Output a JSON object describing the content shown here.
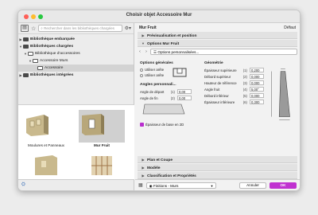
{
  "window": {
    "title": "Choisir objet Accessoire Mur"
  },
  "left": {
    "search_placeholder": "Rechercher dans les bibliothèques chargées",
    "tree": [
      {
        "label": "Bibliothèque embarquée",
        "bold": true
      },
      {
        "label": "Bibliothèques chargées",
        "bold": true
      },
      {
        "label": "Bibliothèque d'accessoires",
        "bold": false
      },
      {
        "label": "Accessoire Murs",
        "bold": false
      },
      {
        "label": "Accessoire",
        "bold": false
      },
      {
        "label": "Bibliothèques intégrées",
        "bold": true
      }
    ],
    "thumbs": [
      {
        "label": "Moulures et Panneaux"
      },
      {
        "label": "Mur Fruit"
      }
    ]
  },
  "right": {
    "object_name": "Mur Fruit",
    "default_label": "Défaut",
    "sections": {
      "preview": "Prévisualisation et position",
      "options": "Options Mur Fruit",
      "plan": "Plan et Coupe",
      "model": "Modèle",
      "classification": "Classification et Propriétés"
    },
    "options_select": "Options personnalisées...",
    "general": {
      "title": "Options générales",
      "radio1": "Utiliser arête",
      "radio2": "Utiliser arête"
    },
    "angles": {
      "title": "Angles personnali...",
      "rows": [
        {
          "label": "Angle de départ",
          "idx": "(1)",
          "value": "0,00"
        },
        {
          "label": "Angle de fin",
          "idx": "(2)",
          "value": "0,00"
        }
      ]
    },
    "geometry": {
      "title": "Géométrie",
      "rows": [
        {
          "label": "Épaisseur supérieure",
          "idx": "(1)",
          "value": "0,200"
        },
        {
          "label": "Débord supérieur",
          "idx": "(2)",
          "value": "0,000"
        },
        {
          "label": "Hauteur de référence",
          "idx": "(3)",
          "value": "0,000"
        },
        {
          "label": "Angle fruit",
          "idx": "(4)",
          "value": "5,00°"
        },
        {
          "label": "Débord inférieur",
          "idx": "(5)",
          "value": "0,000"
        },
        {
          "label": "Épaisseur inférieure",
          "idx": "(6)",
          "value": "0,300"
        }
      ]
    },
    "checkbox_label": "Épaisseur de base en 2D",
    "bottom": {
      "finish_dropdown": "Finitions - Murs",
      "cancel": "Annuler",
      "ok": "OK"
    }
  }
}
